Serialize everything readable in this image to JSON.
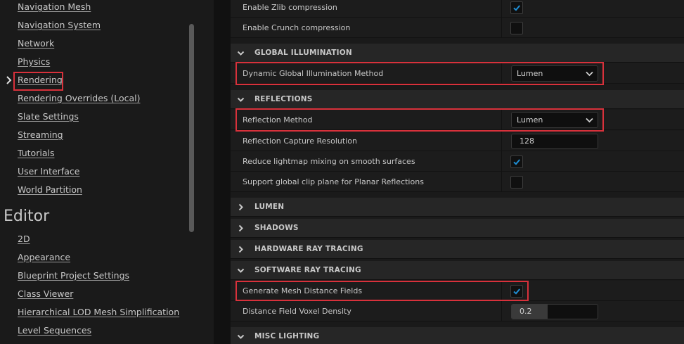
{
  "sidebar": {
    "items_top": [
      {
        "label": "Navigation Mesh"
      },
      {
        "label": "Navigation System"
      },
      {
        "label": "Network"
      },
      {
        "label": "Physics"
      },
      {
        "label": "Rendering",
        "active": true
      },
      {
        "label": "Rendering Overrides (Local)"
      },
      {
        "label": "Slate Settings"
      },
      {
        "label": "Streaming"
      },
      {
        "label": "Tutorials"
      },
      {
        "label": "User Interface"
      },
      {
        "label": "World Partition"
      }
    ],
    "editor_heading": "Editor",
    "items_editor": [
      {
        "label": "2D"
      },
      {
        "label": "Appearance"
      },
      {
        "label": "Blueprint Project Settings"
      },
      {
        "label": "Class Viewer"
      },
      {
        "label": "Hierarchical LOD Mesh Simplification"
      },
      {
        "label": "Level Sequences"
      }
    ]
  },
  "details": {
    "rows": {
      "zlib": {
        "label": "Enable Zlib compression",
        "checked": true
      },
      "crunch": {
        "label": "Enable Crunch compression",
        "checked": false
      },
      "dgi_method": {
        "label": "Dynamic Global Illumination Method",
        "value": "Lumen"
      },
      "reflection_method": {
        "label": "Reflection Method",
        "value": "Lumen"
      },
      "capture_res": {
        "label": "Reflection Capture Resolution",
        "value": "128"
      },
      "lightmap_mixing": {
        "label": "Reduce lightmap mixing on smooth surfaces",
        "checked": true
      },
      "clip_plane": {
        "label": "Support global clip plane for Planar Reflections",
        "checked": false
      },
      "mesh_df": {
        "label": "Generate Mesh Distance Fields",
        "checked": true
      },
      "voxel_density": {
        "label": "Distance Field Voxel Density",
        "value": "0.2",
        "fill": 0.42
      }
    },
    "sections": {
      "gi": {
        "label": "GLOBAL ILLUMINATION",
        "expanded": true
      },
      "reflections": {
        "label": "REFLECTIONS",
        "expanded": true
      },
      "lumen": {
        "label": "LUMEN",
        "expanded": false
      },
      "shadows": {
        "label": "SHADOWS",
        "expanded": false
      },
      "hw_rt": {
        "label": "HARDWARE RAY TRACING",
        "expanded": false
      },
      "sw_rt": {
        "label": "SOFTWARE RAY TRACING",
        "expanded": true
      },
      "misc": {
        "label": "MISC LIGHTING",
        "expanded": true
      }
    }
  },
  "colors": {
    "highlight": "#d8313b",
    "check": "#1f8fd6",
    "background": "#1a1a1a"
  }
}
